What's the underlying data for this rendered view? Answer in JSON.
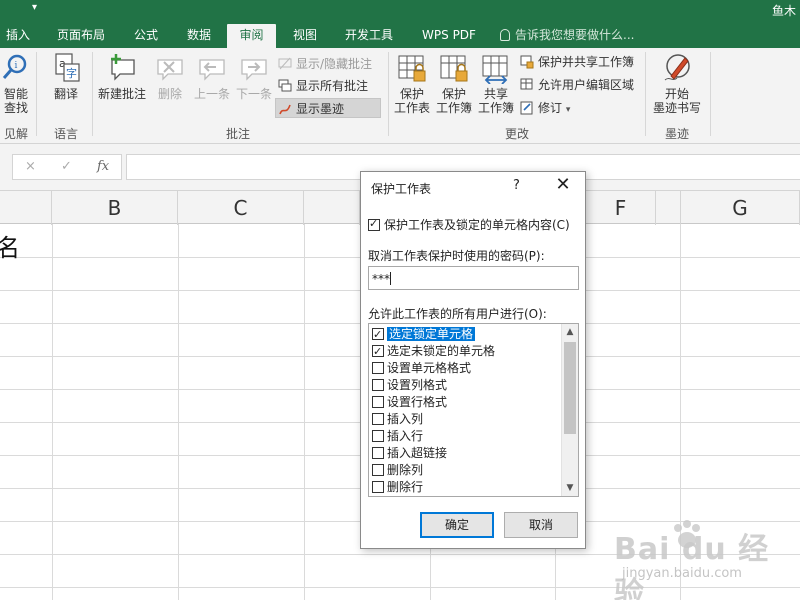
{
  "app": {
    "user_name": "鱼木",
    "accent": "#217346"
  },
  "tabs": [
    {
      "label": "插入",
      "active": false
    },
    {
      "label": "页面布局",
      "active": false
    },
    {
      "label": "公式",
      "active": false
    },
    {
      "label": "数据",
      "active": false
    },
    {
      "label": "审阅",
      "active": true
    },
    {
      "label": "视图",
      "active": false
    },
    {
      "label": "开发工具",
      "active": false
    },
    {
      "label": "WPS PDF",
      "active": false
    }
  ],
  "tell_me": "告诉我您想要做什么...",
  "ribbon": {
    "insights": {
      "smart_lookup_1": "智能",
      "smart_lookup_2": "查找",
      "group": "见解"
    },
    "language": {
      "translate": "翻译",
      "group": "语言"
    },
    "comments": {
      "new": "新建批注",
      "delete": "删除",
      "prev": "上一条",
      "next": "下一条",
      "show_hide": "显示/隐藏批注",
      "show_all": "显示所有批注",
      "show_ink": "显示墨迹",
      "group": "批注"
    },
    "changes": {
      "protect_sheet_1": "保护",
      "protect_sheet_2": "工作表",
      "protect_wb_1": "保护",
      "protect_wb_2": "工作簿",
      "share_wb_1": "共享",
      "share_wb_2": "工作簿",
      "protect_share": "保护并共享工作簿",
      "allow_edit": "允许用户编辑区域",
      "track": "修订",
      "group": "更改"
    },
    "ink": {
      "start_1": "开始",
      "start_2": "墨迹书写",
      "group": "墨迹"
    }
  },
  "formula_bar": {
    "cancel_icon": "×",
    "enter_icon": "✓",
    "fx": "fx"
  },
  "columns": [
    "B",
    "C",
    "F",
    "G"
  ],
  "cells": {
    "a1_fragment": "名"
  },
  "dialog": {
    "title": "保护工作表",
    "help": "?",
    "close": "✕",
    "protect_label": "保护工作表及锁定的单元格内容(C)",
    "protect_checked": true,
    "password_label": "取消工作表保护时使用的密码(P):",
    "password_value": "***",
    "allow_label": "允许此工作表的所有用户进行(O):",
    "permissions": [
      {
        "label": "选定锁定单元格",
        "checked": true,
        "selected": true
      },
      {
        "label": "选定未锁定的单元格",
        "checked": true,
        "selected": false
      },
      {
        "label": "设置单元格格式",
        "checked": false,
        "selected": false
      },
      {
        "label": "设置列格式",
        "checked": false,
        "selected": false
      },
      {
        "label": "设置行格式",
        "checked": false,
        "selected": false
      },
      {
        "label": "插入列",
        "checked": false,
        "selected": false
      },
      {
        "label": "插入行",
        "checked": false,
        "selected": false
      },
      {
        "label": "插入超链接",
        "checked": false,
        "selected": false
      },
      {
        "label": "删除列",
        "checked": false,
        "selected": false
      },
      {
        "label": "删除行",
        "checked": false,
        "selected": false
      }
    ],
    "ok": "确定",
    "cancel": "取消"
  },
  "watermark": {
    "main": "Bai du 经验",
    "sub": "jingyan.baidu.com"
  }
}
